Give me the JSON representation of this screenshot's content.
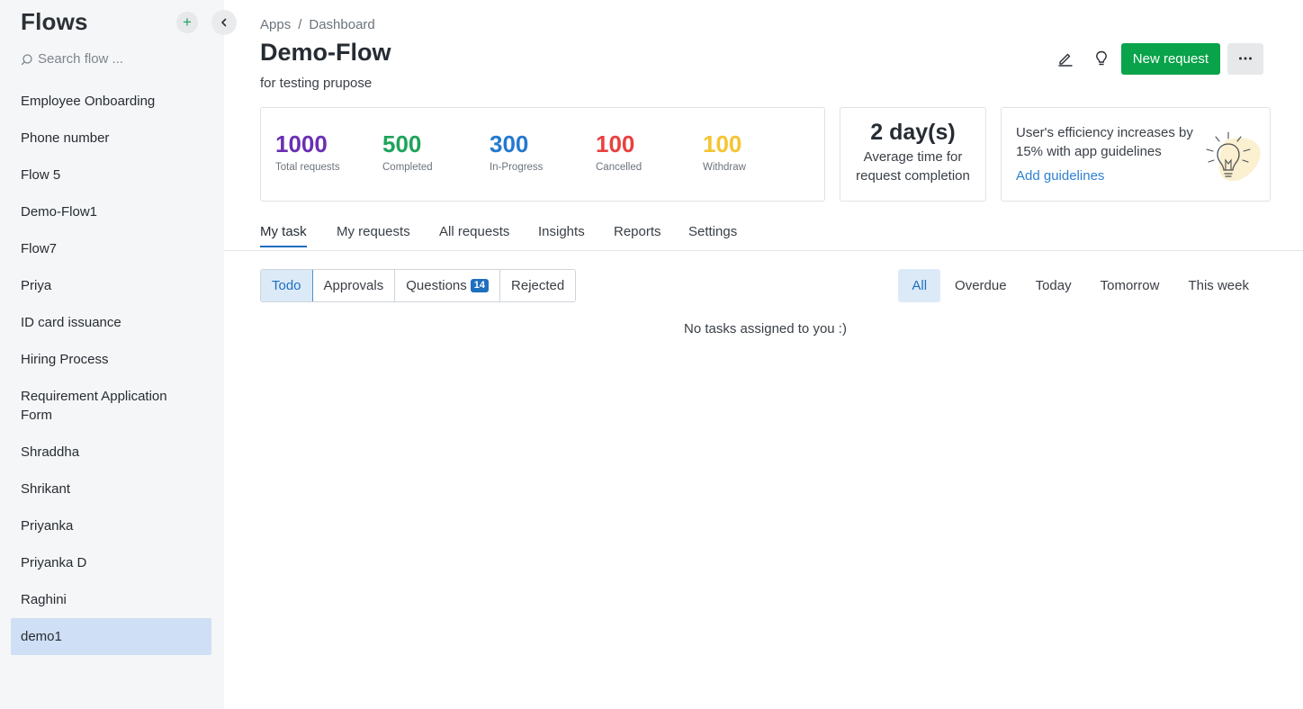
{
  "sidebar": {
    "title": "Flows",
    "add_label": "+",
    "search_placeholder": "Search flow ...",
    "items": [
      {
        "label": "Employee Onboarding"
      },
      {
        "label": "Phone number"
      },
      {
        "label": "Flow 5"
      },
      {
        "label": "Demo-Flow1"
      },
      {
        "label": "Flow7"
      },
      {
        "label": "Priya"
      },
      {
        "label": "ID card issuance"
      },
      {
        "label": "Hiring Process"
      },
      {
        "label": "Requirement Application Form"
      },
      {
        "label": "Shraddha"
      },
      {
        "label": "Shrikant"
      },
      {
        "label": "Priyanka"
      },
      {
        "label": "Priyanka D"
      },
      {
        "label": "Raghini"
      },
      {
        "label": "demo1",
        "active": true
      }
    ]
  },
  "header": {
    "breadcrumb": [
      "Apps",
      "Dashboard"
    ],
    "breadcrumb_sep": "/",
    "title": "Demo-Flow",
    "subtitle": "for testing prupose",
    "new_request_label": "New request"
  },
  "stats": [
    {
      "value": "1000",
      "label": "Total requests",
      "color": "#6b2fb3"
    },
    {
      "value": "500",
      "label": "Completed",
      "color": "#1fa35b"
    },
    {
      "value": "300",
      "label": "In-Progress",
      "color": "#2579d0"
    },
    {
      "value": "100",
      "label": "Cancelled",
      "color": "#e8413f"
    },
    {
      "value": "100",
      "label": "Withdraw",
      "color": "#f5c431"
    }
  ],
  "avg_time": {
    "value": "2 day(s)",
    "label": "Average time for request completion"
  },
  "guidelines": {
    "text": "User's efficiency increases by 15% with app guidelines",
    "link": "Add guidelines"
  },
  "tabs": [
    {
      "label": "My task",
      "active": true
    },
    {
      "label": "My requests"
    },
    {
      "label": "All requests"
    },
    {
      "label": "Insights"
    },
    {
      "label": "Reports"
    },
    {
      "label": "Settings"
    }
  ],
  "task_types": [
    {
      "label": "Todo",
      "active": true
    },
    {
      "label": "Approvals"
    },
    {
      "label": "Questions",
      "badge": "14"
    },
    {
      "label": "Rejected"
    }
  ],
  "filters": [
    {
      "label": "All",
      "active": true
    },
    {
      "label": "Overdue"
    },
    {
      "label": "Today"
    },
    {
      "label": "Tomorrow"
    },
    {
      "label": "This week"
    }
  ],
  "empty_message": "No tasks assigned to you :)"
}
